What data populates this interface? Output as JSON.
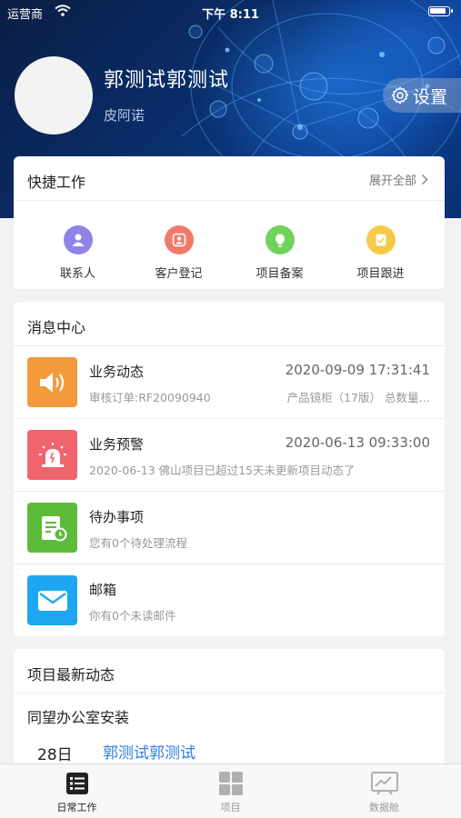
{
  "status_bar": {
    "carrier": "运营商",
    "time": "下午 8:11"
  },
  "profile": {
    "name": "郭测试郭测试",
    "company": "皮阿诺",
    "settings_label": "设置"
  },
  "quick_work": {
    "title": "快捷工作",
    "expand_label": "展开全部",
    "items": [
      {
        "label": "联系人",
        "icon": "contact-icon",
        "color": "#8e84e8"
      },
      {
        "label": "客户登记",
        "icon": "customer-register-icon",
        "color": "#f07a6a"
      },
      {
        "label": "项目备案",
        "icon": "project-record-icon",
        "color": "#6fd35c"
      },
      {
        "label": "项目跟进",
        "icon": "project-follow-icon",
        "color": "#f7c948"
      }
    ]
  },
  "message_center": {
    "title": "消息中心",
    "items": [
      {
        "title": "业务动态",
        "time": "2020-09-09 17:31:41",
        "subtitle": "审核订单:RF20090940",
        "subtitle_right": "产品镜柜（17版）  总数量…",
        "icon": "speaker-icon",
        "color": "#f39a3d"
      },
      {
        "title": "业务预警",
        "time": "2020-06-13 09:33:00",
        "subtitle": "2020-06-13 佛山项目已超过15天未更新项目动态了",
        "icon": "alarm-icon",
        "color": "#f0646e"
      },
      {
        "title": "待办事项",
        "subtitle": "您有0个待处理流程",
        "icon": "todo-icon",
        "color": "#5dbb3a"
      },
      {
        "title": "邮箱",
        "subtitle": "你有0个未读邮件",
        "icon": "mail-icon",
        "color": "#1ea7f0"
      }
    ]
  },
  "project_updates": {
    "title": "项目最新动态",
    "project_name": "同望办公室安装",
    "day": "28日",
    "person": "郭测试郭测试"
  },
  "tab_bar": {
    "tabs": [
      {
        "label": "日常工作",
        "icon": "daily-work-icon",
        "active": true
      },
      {
        "label": "项目",
        "icon": "project-grid-icon",
        "active": false
      },
      {
        "label": "数据舱",
        "icon": "data-chart-icon",
        "active": false
      }
    ]
  }
}
